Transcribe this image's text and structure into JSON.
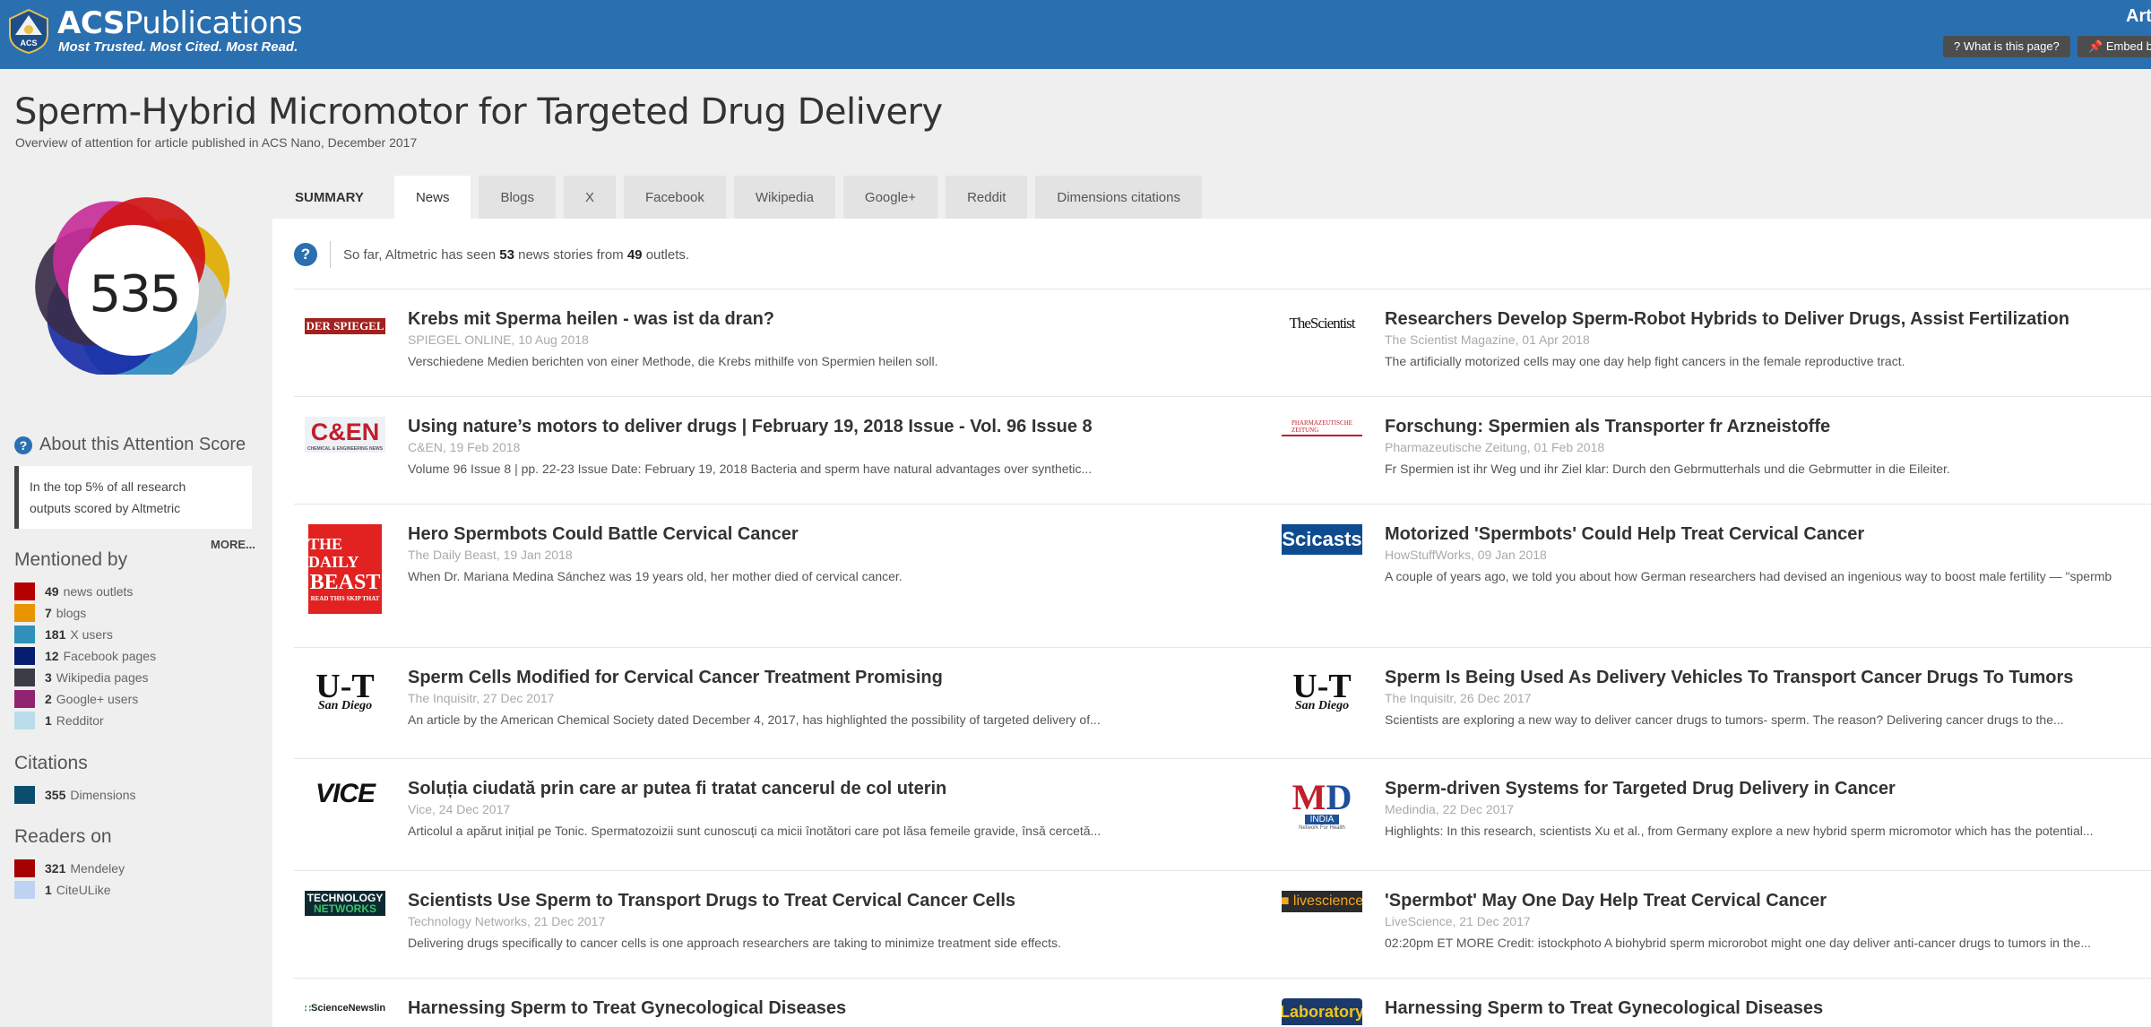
{
  "header": {
    "brand_bold": "ACS",
    "brand_light": "Publications",
    "tagline": "Most Trusted. Most Cited. Most Read.",
    "right_title": "Art",
    "whatis_label": "? What is this page?",
    "embed_label": "Embed ba",
    "color": "#2a6fb0"
  },
  "page": {
    "title": "Sperm-Hybrid Micromotor for Targeted Drug Delivery",
    "subtitle": "Overview of attention for article published in ACS Nano, December 2017"
  },
  "score": "535",
  "donut_colors": [
    "#e0aa00",
    "#c2cedc",
    "#2d8bc0",
    "#1b2fa8",
    "#3a2d4a",
    "#c52f97",
    "#cf1414"
  ],
  "about": {
    "heading": "About this Attention Score",
    "text_line1": "In the top 5% of all research",
    "text_line2": "outputs scored by Altmetric",
    "more": "MORE..."
  },
  "mentioned": {
    "heading": "Mentioned by",
    "items": [
      {
        "count": "49",
        "label": "news outlets",
        "color": "#b60000"
      },
      {
        "count": "7",
        "label": "blogs",
        "color": "#e89500"
      },
      {
        "count": "181",
        "label": "X users",
        "color": "#2f90b9"
      },
      {
        "count": "12",
        "label": "Facebook pages",
        "color": "#071d70"
      },
      {
        "count": "3",
        "label": "Wikipedia pages",
        "color": "#3c3c46"
      },
      {
        "count": "2",
        "label": "Google+ users",
        "color": "#912470"
      },
      {
        "count": "1",
        "label": "Redditor",
        "color": "#b9ddeb"
      }
    ]
  },
  "citations": {
    "heading": "Citations",
    "items": [
      {
        "count": "355",
        "label": "Dimensions",
        "color": "#0b4d6f"
      }
    ]
  },
  "readers": {
    "heading": "Readers on",
    "items": [
      {
        "count": "321",
        "label": "Mendeley",
        "color": "#a60000"
      },
      {
        "count": "1",
        "label": "CiteULike",
        "color": "#bed3f1"
      }
    ]
  },
  "tabs": [
    "SUMMARY",
    "News",
    "Blogs",
    "X",
    "Facebook",
    "Wikipedia",
    "Google+",
    "Reddit",
    "Dimensions citations"
  ],
  "intro": {
    "icon": "?",
    "pre": "So far, Altmetric has seen",
    "stories": "53",
    "mid": "news stories from",
    "outlets": "49",
    "post": "outlets."
  },
  "stories": [
    {
      "logo": "DER SPIEGEL",
      "title": "Krebs mit Sperma heilen - was ist da dran?",
      "meta": "SPIEGEL ONLINE, 10 Aug 2018",
      "snippet": "Verschiedene Medien berichten von einer Methode, die Krebs mithilfe von Spermien heilen soll."
    },
    {
      "logo": "TheScientist",
      "title": "Researchers Develop Sperm-Robot Hybrids to Deliver Drugs, Assist Fertilization",
      "meta": "The Scientist Magazine, 01 Apr 2018",
      "snippet": "The artificially motorized cells may one day help fight cancers in the female reproductive tract."
    },
    {
      "logo": "C&EN",
      "title": "Using nature’s motors to deliver drugs | February 19, 2018 Issue - Vol. 96 Issue 8",
      "meta": "C&EN, 19 Feb 2018",
      "snippet": "Volume 96 Issue 8 | pp. 22-23 Issue Date: February 19, 2018 Bacteria and sperm have natural advantages over synthetic..."
    },
    {
      "logo": "PHARMAZEUTISCHE ZEITUNG",
      "title": "Forschung: Spermien als Transporter fr Arzneistoffe",
      "meta": "Pharmazeutische Zeitung, 01 Feb 2018",
      "snippet": "Fr Spermien ist ihr Weg und ihr Ziel klar: Durch den Gebrmutterhals und die Gebrmutter in die Eileiter."
    },
    {
      "logo": "THE DAILY BEAST",
      "title": "Hero Spermbots Could Battle Cervical Cancer",
      "meta": "The Daily Beast, 19 Jan 2018",
      "snippet": "When Dr. Mariana Medina Sánchez was 19 years old, her mother died of cervical cancer."
    },
    {
      "logo": "Scicasts",
      "title": "Motorized 'Spermbots' Could Help Treat Cervical Cancer",
      "meta": "HowStuffWorks, 09 Jan 2018",
      "snippet": "A couple of years ago, we told you about how German researchers had devised an ingenious way to boost male fertility — \"spermb"
    },
    {
      "logo": "U-T San Diego",
      "title": "Sperm Cells Modified for Cervical Cancer Treatment Promising",
      "meta": "The Inquisitr, 27 Dec 2017",
      "snippet": "An article by the American Chemical Society dated December 4, 2017, has highlighted the possibility of targeted delivery of..."
    },
    {
      "logo": "U-T San Diego",
      "title": "Sperm Is Being Used As Delivery Vehicles To Transport Cancer Drugs To Tumors",
      "meta": "The Inquisitr, 26 Dec 2017",
      "snippet": "Scientists are exploring a new way to deliver cancer drugs to tumors- sperm. The reason? Delivering cancer drugs to the..."
    },
    {
      "logo": "VICE",
      "title": "Soluția ciudată prin care ar putea fi tratat cancerul de col uterin",
      "meta": "Vice, 24 Dec 2017",
      "snippet": "Articolul a apărut inițial pe Tonic. Spermatozoizii sunt cunoscuți ca micii înotători care pot lăsa femeile gravide, însă cercetă..."
    },
    {
      "logo": "MD INDIA",
      "title": "Sperm-driven Systems for Targeted Drug Delivery in Cancer",
      "meta": "Medindia, 22 Dec 2017",
      "snippet": "Highlights: In this research, scientists Xu et al., from Germany explore a new hybrid sperm micromotor which has the potential..."
    },
    {
      "logo": "TECHNOLOGY NETWORKS",
      "title": "Scientists Use Sperm to Transport Drugs to Treat Cervical Cancer Cells",
      "meta": "Technology Networks, 21 Dec 2017",
      "snippet": "Delivering drugs specifically to cancer cells is one approach researchers are taking to minimize treatment side effects."
    },
    {
      "logo": "livescience",
      "title": "'Spermbot' May One Day Help Treat Cervical Cancer",
      "meta": "LiveScience, 21 Dec 2017",
      "snippet": "02:20pm ET MORE Credit: istockphoto A biohybrid sperm microrobot might one day deliver anti-cancer drugs to tumors in the..."
    },
    {
      "logo": "ScienceNewsline",
      "title": "Harnessing Sperm to Treat Gynecological Diseases",
      "meta": "",
      "snippet": ""
    },
    {
      "logo": "Laboratory",
      "title": "Harnessing Sperm to Treat Gynecological Diseases",
      "meta": "",
      "snippet": ""
    }
  ]
}
